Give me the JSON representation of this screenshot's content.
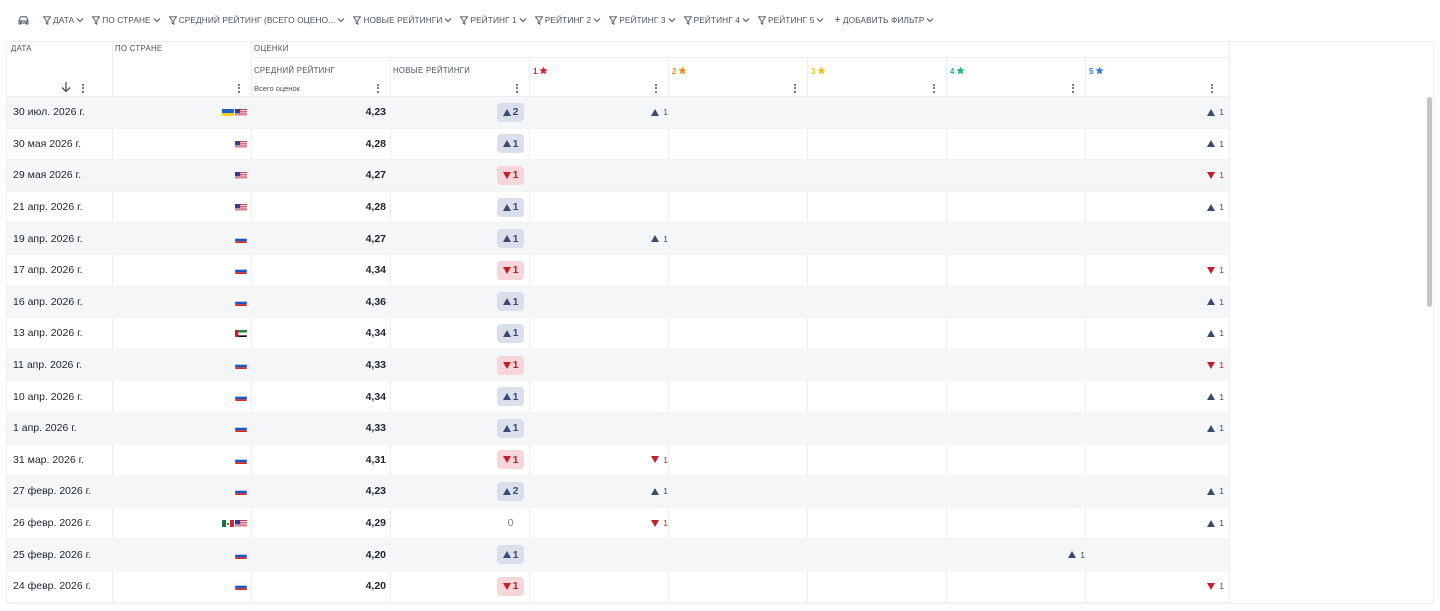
{
  "filters": [
    {
      "label": "ДАТА"
    },
    {
      "label": "ПО СТРАНЕ"
    },
    {
      "label": "СРЕДНИЙ РЕЙТИНГ (ВСЕГО ОЦЕНО..."
    },
    {
      "label": "НОВЫЕ РЕЙТИНГИ"
    },
    {
      "label": "РЕЙТИНГ 1"
    },
    {
      "label": "РЕЙТИНГ 2"
    },
    {
      "label": "РЕЙТИНГ 3"
    },
    {
      "label": "РЕЙТИНГ 4"
    },
    {
      "label": "РЕЙТИНГ 5"
    }
  ],
  "add_filter_label": "ДОБАВИТЬ ФИЛЬТР",
  "header": {
    "date": "ДАТА",
    "country": "ПО СТРАНЕ",
    "ratings_group": "ОЦЕНКИ",
    "avg_rating": "СРЕДНИЙ РЕЙТИНГ",
    "avg_sub": "Всего оценок",
    "new_ratings": "НОВЫЕ РЕЙТИНГИ",
    "stars": [
      {
        "label": "1",
        "color": "#d6202f"
      },
      {
        "label": "2",
        "color": "#f08c1e"
      },
      {
        "label": "3",
        "color": "#e8c21a"
      },
      {
        "label": "4",
        "color": "#1fb58a"
      },
      {
        "label": "5",
        "color": "#2f7be5"
      }
    ]
  },
  "rows": [
    {
      "date": "30 июл. 2026 г.",
      "flags": [
        "ua",
        "us"
      ],
      "avg": "4,23",
      "new": {
        "dir": "up",
        "val": "2"
      },
      "deltas": [
        {
          "star": 1,
          "dir": "up",
          "val": "1"
        },
        {
          "star": 5,
          "dir": "up",
          "val": "1"
        }
      ]
    },
    {
      "date": "30 мая 2026 г.",
      "flags": [
        "us"
      ],
      "avg": "4,28",
      "new": {
        "dir": "up",
        "val": "1"
      },
      "deltas": [
        {
          "star": 5,
          "dir": "up",
          "val": "1"
        }
      ]
    },
    {
      "date": "29 мая 2026 г.",
      "flags": [
        "us"
      ],
      "avg": "4,27",
      "new": {
        "dir": "down",
        "val": "1"
      },
      "deltas": [
        {
          "star": 5,
          "dir": "down",
          "val": "1"
        }
      ]
    },
    {
      "date": "21 апр. 2026 г.",
      "flags": [
        "us"
      ],
      "avg": "4,28",
      "new": {
        "dir": "up",
        "val": "1"
      },
      "deltas": [
        {
          "star": 5,
          "dir": "up",
          "val": "1"
        }
      ]
    },
    {
      "date": "19 апр. 2026 г.",
      "flags": [
        "ru"
      ],
      "avg": "4,27",
      "new": {
        "dir": "up",
        "val": "1"
      },
      "deltas": [
        {
          "star": 1,
          "dir": "up",
          "val": "1"
        }
      ]
    },
    {
      "date": "17 апр. 2026 г.",
      "flags": [
        "ru"
      ],
      "avg": "4,34",
      "new": {
        "dir": "down",
        "val": "1"
      },
      "deltas": [
        {
          "star": 5,
          "dir": "down",
          "val": "1"
        }
      ]
    },
    {
      "date": "16 апр. 2026 г.",
      "flags": [
        "ru"
      ],
      "avg": "4,36",
      "new": {
        "dir": "up",
        "val": "1"
      },
      "deltas": [
        {
          "star": 5,
          "dir": "up",
          "val": "1"
        }
      ]
    },
    {
      "date": "13 апр. 2026 г.",
      "flags": [
        "ae"
      ],
      "avg": "4,34",
      "new": {
        "dir": "up",
        "val": "1"
      },
      "deltas": [
        {
          "star": 5,
          "dir": "up",
          "val": "1"
        }
      ]
    },
    {
      "date": "11 апр. 2026 г.",
      "flags": [
        "ru"
      ],
      "avg": "4,33",
      "new": {
        "dir": "down",
        "val": "1"
      },
      "deltas": [
        {
          "star": 5,
          "dir": "down",
          "val": "1"
        }
      ]
    },
    {
      "date": "10 апр. 2026 г.",
      "flags": [
        "ru"
      ],
      "avg": "4,34",
      "new": {
        "dir": "up",
        "val": "1"
      },
      "deltas": [
        {
          "star": 5,
          "dir": "up",
          "val": "1"
        }
      ]
    },
    {
      "date": "1 апр. 2026 г.",
      "flags": [
        "ru"
      ],
      "avg": "4,33",
      "new": {
        "dir": "up",
        "val": "1"
      },
      "deltas": [
        {
          "star": 5,
          "dir": "up",
          "val": "1"
        }
      ]
    },
    {
      "date": "31 мар. 2026 г.",
      "flags": [
        "ru"
      ],
      "avg": "4,31",
      "new": {
        "dir": "down",
        "val": "1"
      },
      "deltas": [
        {
          "star": 1,
          "dir": "down",
          "val": "1"
        }
      ]
    },
    {
      "date": "27 февр. 2026 г.",
      "flags": [
        "ru"
      ],
      "avg": "4,23",
      "new": {
        "dir": "up",
        "val": "2"
      },
      "deltas": [
        {
          "star": 1,
          "dir": "up",
          "val": "1"
        },
        {
          "star": 5,
          "dir": "up",
          "val": "1"
        }
      ]
    },
    {
      "date": "26 февр. 2026 г.",
      "flags": [
        "mx",
        "us"
      ],
      "avg": "4,29",
      "new": {
        "dir": "zero",
        "val": "0"
      },
      "deltas": [
        {
          "star": 1,
          "dir": "down",
          "val": "1"
        },
        {
          "star": 5,
          "dir": "up",
          "val": "1"
        }
      ]
    },
    {
      "date": "25 февр. 2026 г.",
      "flags": [
        "ru"
      ],
      "avg": "4,20",
      "new": {
        "dir": "up",
        "val": "1"
      },
      "deltas": [
        {
          "star": 4,
          "dir": "up",
          "val": "1"
        }
      ]
    },
    {
      "date": "24 февр. 2026 г.",
      "flags": [
        "ru"
      ],
      "avg": "4,20",
      "new": {
        "dir": "down",
        "val": "1"
      },
      "deltas": [
        {
          "star": 5,
          "dir": "down",
          "val": "1"
        }
      ]
    }
  ]
}
